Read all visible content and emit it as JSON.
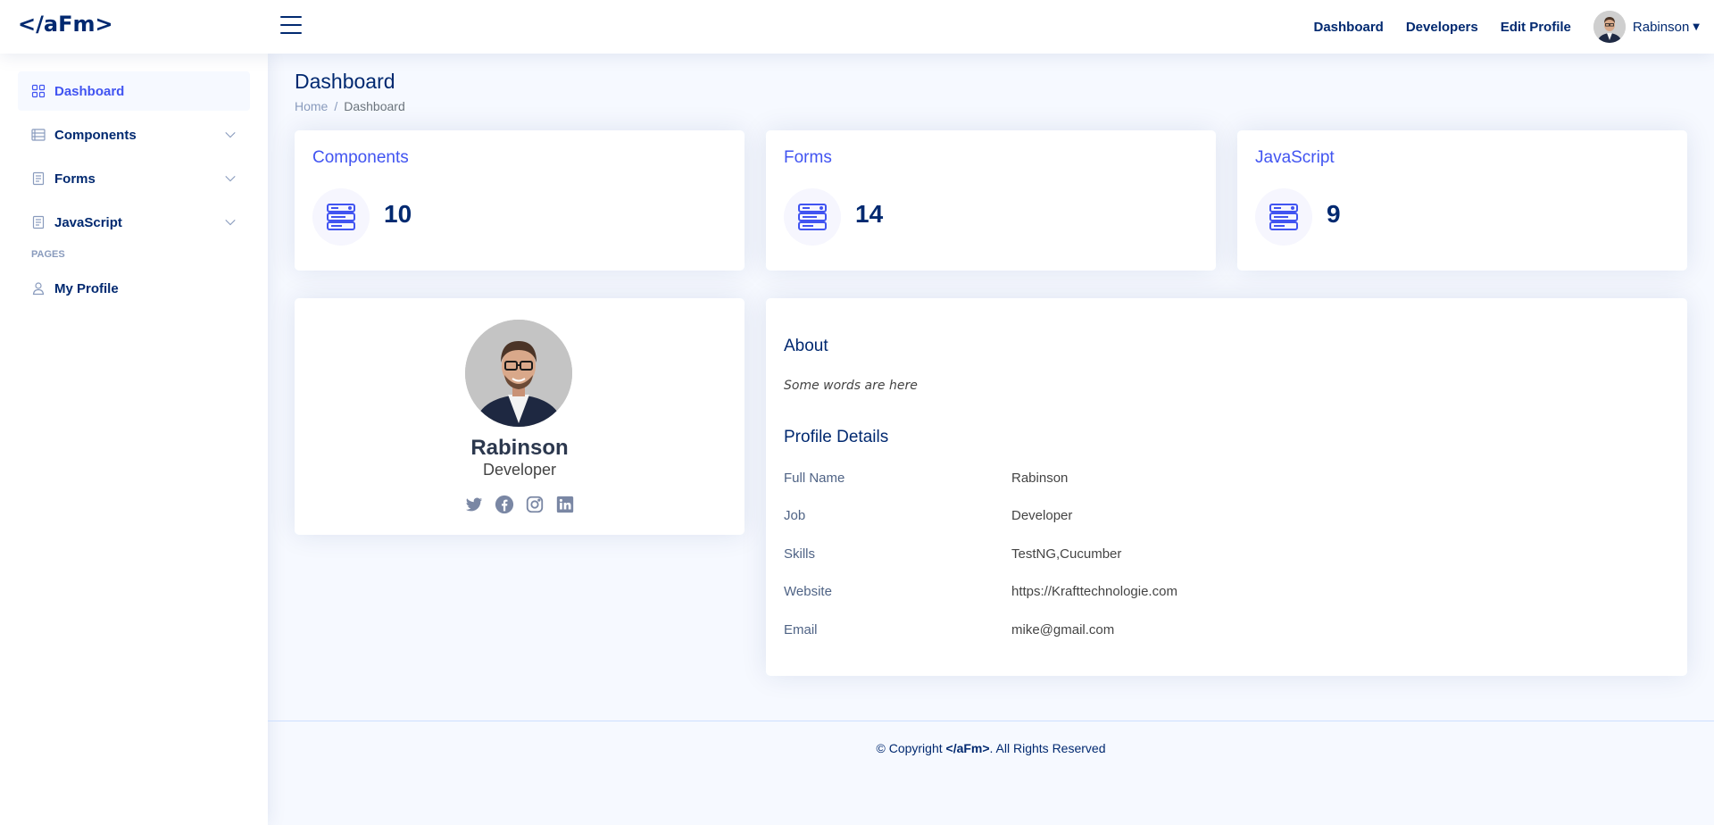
{
  "header": {
    "logo": "</aFm>",
    "nav": [
      "Dashboard",
      "Developers",
      "Edit Profile"
    ],
    "user_name": "Rabinson"
  },
  "sidebar": {
    "items": [
      {
        "label": "Dashboard",
        "icon": "grid-icon",
        "active": true
      },
      {
        "label": "Components",
        "icon": "menu-icon"
      },
      {
        "label": "Forms",
        "icon": "journal-icon"
      },
      {
        "label": "JavaScript",
        "icon": "journal-icon"
      }
    ],
    "pages_heading": "PAGES",
    "pages": [
      {
        "label": "My Profile",
        "icon": "person-icon"
      }
    ]
  },
  "page": {
    "title": "Dashboard",
    "breadcrumb": [
      "Home",
      "/",
      "Dashboard"
    ]
  },
  "stats": [
    {
      "title": "Components",
      "value": "10"
    },
    {
      "title": "Forms",
      "value": "14"
    },
    {
      "title": "JavaScript",
      "value": "9"
    }
  ],
  "profile": {
    "name": "Rabinson",
    "job": "Developer",
    "socials": [
      "twitter-icon",
      "facebook-icon",
      "instagram-icon",
      "linkedin-icon"
    ]
  },
  "about": {
    "heading": "About",
    "text": "Some words are here",
    "details_heading": "Profile Details",
    "rows": [
      {
        "label": "Full Name",
        "value": "Rabinson"
      },
      {
        "label": "Job",
        "value": "Developer"
      },
      {
        "label": "Skills",
        "value": "TestNG,Cucumber"
      },
      {
        "label": "Website",
        "value": "https://Krafttechnologie.com"
      },
      {
        "label": "Email",
        "value": "mike@gmail.com"
      }
    ]
  },
  "footer": {
    "prefix": "© Copyright ",
    "brand": "</aFm>",
    "suffix": ". All Rights Reserved"
  },
  "colors": {
    "accent": "#4154f1",
    "navy": "#012970",
    "bg": "#f6f9ff",
    "muted": "#899bbd"
  }
}
